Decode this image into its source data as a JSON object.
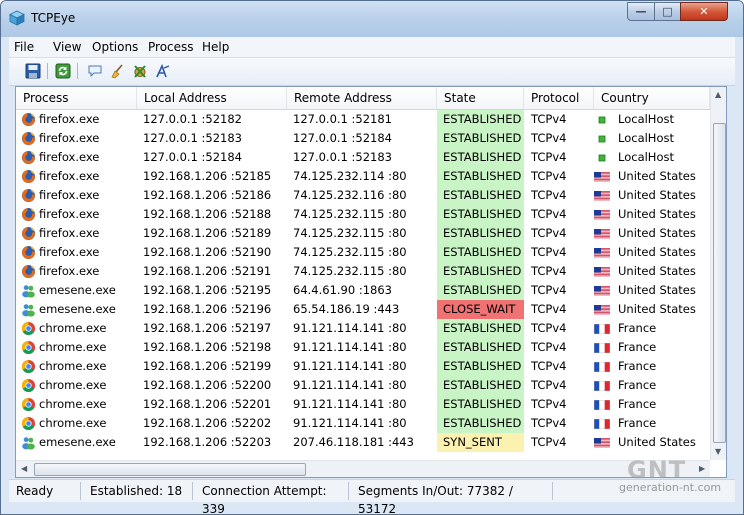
{
  "window": {
    "title": "TCPEye"
  },
  "menu": [
    "File",
    "View",
    "Options",
    "Process",
    "Help"
  ],
  "toolbar_icons": [
    "save-icon",
    "refresh-icon",
    "comment-icon",
    "broom-icon",
    "kill-process-icon",
    "whois-icon"
  ],
  "columns": [
    "Process",
    "Local Address",
    "Remote Address",
    "State",
    "Protocol",
    "Country"
  ],
  "state_colors": {
    "ESTABLISHED": "#c9f4c6",
    "CLOSE_WAIT": "#f07272",
    "SYN_SENT": "#fbf2b2"
  },
  "rows": [
    {
      "process": "firefox.exe",
      "icon": "firefox-icon",
      "local": "127.0.0.1 :52182",
      "remote": "127.0.0.1 :52181",
      "state": "ESTABLISHED",
      "protocol": "TCPv4",
      "country": "LocalHost",
      "flag": "localhost"
    },
    {
      "process": "firefox.exe",
      "icon": "firefox-icon",
      "local": "127.0.0.1 :52183",
      "remote": "127.0.0.1 :52184",
      "state": "ESTABLISHED",
      "protocol": "TCPv4",
      "country": "LocalHost",
      "flag": "localhost"
    },
    {
      "process": "firefox.exe",
      "icon": "firefox-icon",
      "local": "127.0.0.1 :52184",
      "remote": "127.0.0.1 :52183",
      "state": "ESTABLISHED",
      "protocol": "TCPv4",
      "country": "LocalHost",
      "flag": "localhost"
    },
    {
      "process": "firefox.exe",
      "icon": "firefox-icon",
      "local": "192.168.1.206 :52185",
      "remote": "74.125.232.114 :80",
      "state": "ESTABLISHED",
      "protocol": "TCPv4",
      "country": "United States",
      "flag": "us"
    },
    {
      "process": "firefox.exe",
      "icon": "firefox-icon",
      "local": "192.168.1.206 :52186",
      "remote": "74.125.232.116 :80",
      "state": "ESTABLISHED",
      "protocol": "TCPv4",
      "country": "United States",
      "flag": "us"
    },
    {
      "process": "firefox.exe",
      "icon": "firefox-icon",
      "local": "192.168.1.206 :52188",
      "remote": "74.125.232.115 :80",
      "state": "ESTABLISHED",
      "protocol": "TCPv4",
      "country": "United States",
      "flag": "us"
    },
    {
      "process": "firefox.exe",
      "icon": "firefox-icon",
      "local": "192.168.1.206 :52189",
      "remote": "74.125.232.115 :80",
      "state": "ESTABLISHED",
      "protocol": "TCPv4",
      "country": "United States",
      "flag": "us"
    },
    {
      "process": "firefox.exe",
      "icon": "firefox-icon",
      "local": "192.168.1.206 :52190",
      "remote": "74.125.232.115 :80",
      "state": "ESTABLISHED",
      "protocol": "TCPv4",
      "country": "United States",
      "flag": "us"
    },
    {
      "process": "firefox.exe",
      "icon": "firefox-icon",
      "local": "192.168.1.206 :52191",
      "remote": "74.125.232.115 :80",
      "state": "ESTABLISHED",
      "protocol": "TCPv4",
      "country": "United States",
      "flag": "us"
    },
    {
      "process": "emesene.exe",
      "icon": "emesene-icon",
      "local": "192.168.1.206 :52195",
      "remote": "64.4.61.90 :1863",
      "state": "ESTABLISHED",
      "protocol": "TCPv4",
      "country": "United States",
      "flag": "us"
    },
    {
      "process": "emesene.exe",
      "icon": "emesene-icon",
      "local": "192.168.1.206 :52196",
      "remote": "65.54.186.19 :443",
      "state": "CLOSE_WAIT",
      "protocol": "TCPv4",
      "country": "United States",
      "flag": "us"
    },
    {
      "process": "chrome.exe",
      "icon": "chrome-icon",
      "local": "192.168.1.206 :52197",
      "remote": "91.121.114.141 :80",
      "state": "ESTABLISHED",
      "protocol": "TCPv4",
      "country": "France",
      "flag": "fr"
    },
    {
      "process": "chrome.exe",
      "icon": "chrome-icon",
      "local": "192.168.1.206 :52198",
      "remote": "91.121.114.141 :80",
      "state": "ESTABLISHED",
      "protocol": "TCPv4",
      "country": "France",
      "flag": "fr"
    },
    {
      "process": "chrome.exe",
      "icon": "chrome-icon",
      "local": "192.168.1.206 :52199",
      "remote": "91.121.114.141 :80",
      "state": "ESTABLISHED",
      "protocol": "TCPv4",
      "country": "France",
      "flag": "fr"
    },
    {
      "process": "chrome.exe",
      "icon": "chrome-icon",
      "local": "192.168.1.206 :52200",
      "remote": "91.121.114.141 :80",
      "state": "ESTABLISHED",
      "protocol": "TCPv4",
      "country": "France",
      "flag": "fr"
    },
    {
      "process": "chrome.exe",
      "icon": "chrome-icon",
      "local": "192.168.1.206 :52201",
      "remote": "91.121.114.141 :80",
      "state": "ESTABLISHED",
      "protocol": "TCPv4",
      "country": "France",
      "flag": "fr"
    },
    {
      "process": "chrome.exe",
      "icon": "chrome-icon",
      "local": "192.168.1.206 :52202",
      "remote": "91.121.114.141 :80",
      "state": "ESTABLISHED",
      "protocol": "TCPv4",
      "country": "France",
      "flag": "fr"
    },
    {
      "process": "emesene.exe",
      "icon": "emesene-icon",
      "local": "192.168.1.206 :52203",
      "remote": "207.46.118.181 :443",
      "state": "SYN_SENT",
      "protocol": "TCPv4",
      "country": "United States",
      "flag": "us"
    }
  ],
  "status": {
    "ready": "Ready",
    "established": "Established: 18",
    "attempt": "Connection Attempt: 339",
    "segments": "Segments In/Out: 77382 / 53172"
  },
  "watermark": {
    "logo": "GNT",
    "site": "generation-nt.com"
  }
}
